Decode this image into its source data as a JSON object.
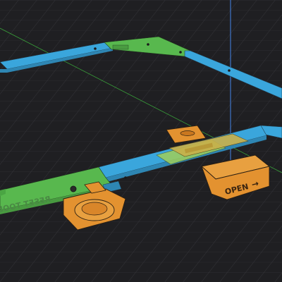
{
  "viewport": {
    "background": "#1f1f22",
    "grid_color": "#35353a",
    "axis_x_color": "#3fbf3f",
    "axis_z_color": "#4a90ff"
  },
  "model": {
    "frame_blue": "#3aa6dc",
    "frame_green": "#58b84e",
    "part_orange": "#e39230",
    "edge_color": "#2b1f12"
  },
  "labels": {
    "button_text": "OPEN",
    "arrow_glyph": "→",
    "engraved_text": "RESET TOOL"
  }
}
